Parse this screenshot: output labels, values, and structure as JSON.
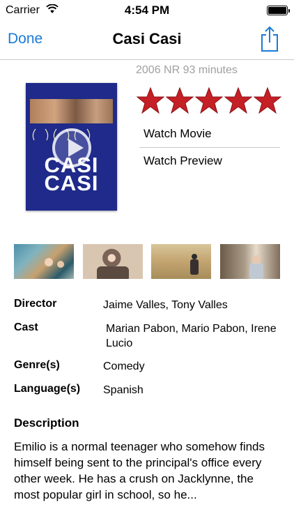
{
  "status_bar": {
    "carrier": "Carrier",
    "time": "4:54 PM"
  },
  "nav": {
    "done_label": "Done",
    "title": "Casi Casi",
    "accent_color": "#1a7ad6"
  },
  "movie": {
    "meta": "2006 NR 93 minutes",
    "rating_stars": 5,
    "star_color": "#c52026",
    "poster": {
      "title": "CASI CASI"
    }
  },
  "actions": {
    "watch_movie": "Watch Movie",
    "watch_preview": "Watch Preview"
  },
  "details": {
    "director_label": "Director",
    "director": "Jaime Valles, Tony Valles",
    "cast_label": "Cast",
    "cast": "Marian Pabon, Mario Pabon, Irene Lucio",
    "genre_label": "Genre(s)",
    "genre": "Comedy",
    "language_label": "Language(s)",
    "language": "Spanish"
  },
  "description": {
    "heading": "Description",
    "text": "Emilio is a normal teenager who somehow finds himself being sent to the principal's office every other week. He has a crush on Jacklynne, the most popular girl in school, so he..."
  }
}
